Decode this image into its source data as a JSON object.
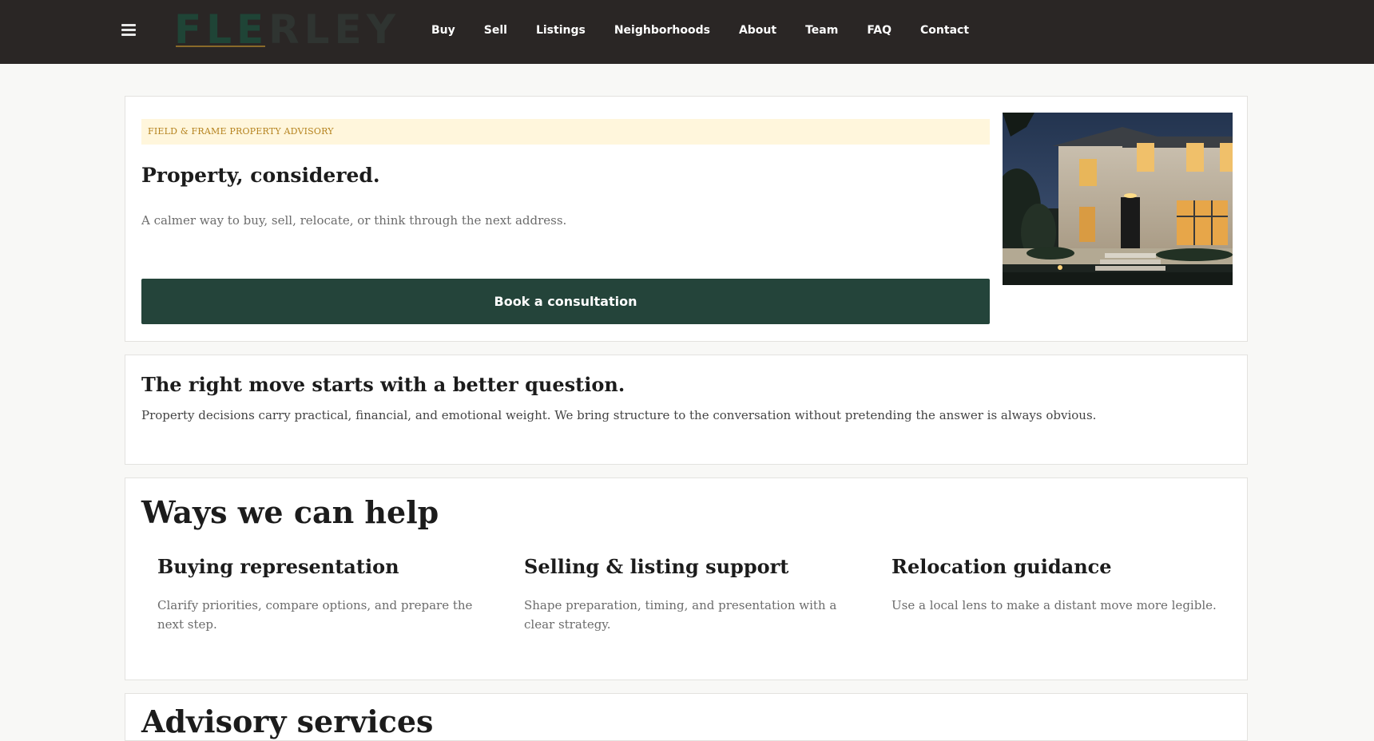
{
  "brand": {
    "logo_lead": "FLE",
    "logo_rest": "RLEY"
  },
  "nav": {
    "items": [
      "Buy",
      "Sell",
      "Listings",
      "Neighborhoods",
      "About",
      "Team",
      "FAQ",
      "Contact"
    ]
  },
  "hero": {
    "eyebrow": "FIELD & FRAME PROPERTY ADVISORY",
    "title": "Property, considered.",
    "subtitle": "A calmer way to buy, sell, relocate, or think through the next address.",
    "cta_label": "Book a consultation"
  },
  "intro": {
    "title": "The right move starts with a better question.",
    "body": "Property decisions carry practical, financial, and emotional weight. We bring structure to the conversation without pretending the answer is always obvious."
  },
  "help": {
    "title": "Ways we can help",
    "services": [
      {
        "title": "Buying representation",
        "body": "Clarify priorities, compare options, and prepare the next step."
      },
      {
        "title": "Selling & listing support",
        "body": "Shape preparation, timing, and presentation with a clear strategy."
      },
      {
        "title": "Relocation guidance",
        "body": "Use a local lens to make a distant move more legible."
      }
    ]
  },
  "advisory": {
    "title": "Advisory services"
  },
  "colors": {
    "header_bg": "#2a2625",
    "accent_green": "#24443a",
    "eyebrow_bg": "#fff6dc",
    "eyebrow_text": "#b5821e"
  }
}
